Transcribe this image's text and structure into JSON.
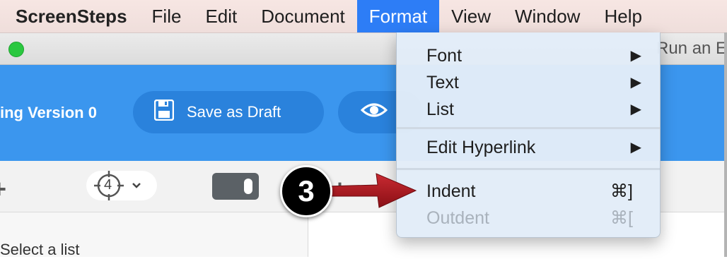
{
  "menubar": {
    "app_name": "ScreenSteps",
    "items": [
      "File",
      "Edit",
      "Document",
      "Format",
      "View",
      "Window",
      "Help"
    ],
    "active_item": "Format"
  },
  "window": {
    "title_fragment": "Run an E"
  },
  "header": {
    "version_label": "ing Version 0",
    "save_draft_label": "Save as Draft"
  },
  "toolbar": {
    "step_counter": "4"
  },
  "sidebar": {
    "select_list_label": "Select a list"
  },
  "format_menu": {
    "items": [
      {
        "label": "Font",
        "submenu": true
      },
      {
        "label": "Text",
        "submenu": true
      },
      {
        "label": "List",
        "submenu": true
      },
      {
        "label": "Edit Hyperlink",
        "submenu": true
      },
      {
        "label": "Indent",
        "shortcut": "⌘]",
        "enabled": true
      },
      {
        "label": "Outdent",
        "shortcut": "⌘[",
        "enabled": false
      }
    ],
    "submenu_arrow": "▶"
  },
  "annotation": {
    "step_number": "3",
    "arrow_color": "#a8141c"
  }
}
